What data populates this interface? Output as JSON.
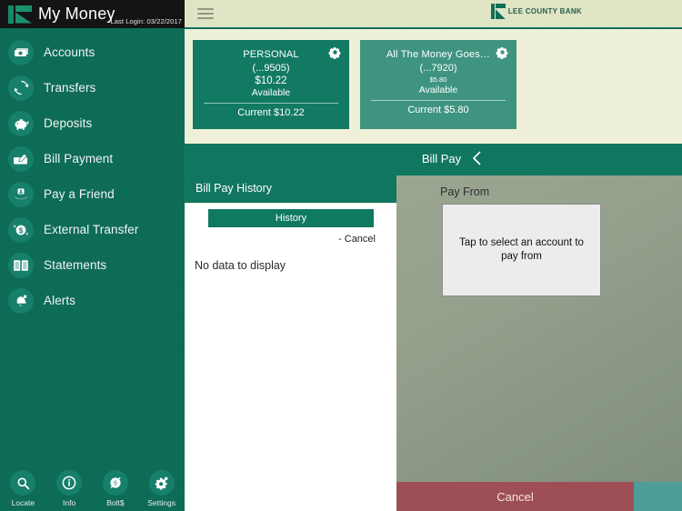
{
  "sidebar": {
    "brand_title": "My Money",
    "last_login": "Last Login: 03/22/2017",
    "brand_mark_icon": "lee-county-bank-logo-mark",
    "items": [
      {
        "label": "Accounts",
        "icon": "money-stack-icon"
      },
      {
        "label": "Transfers",
        "icon": "refresh-arrows-icon"
      },
      {
        "label": "Deposits",
        "icon": "piggy-bank-icon"
      },
      {
        "label": "Bill Payment",
        "icon": "check-pen-icon"
      },
      {
        "label": "Pay a Friend",
        "icon": "person-hand-icon"
      },
      {
        "label": "External Transfer",
        "icon": "dollar-circle-arrows-icon"
      },
      {
        "label": "Statements",
        "icon": "open-book-icon"
      },
      {
        "label": "Alerts",
        "icon": "bell-icon"
      }
    ],
    "tools": [
      {
        "label": "Locate",
        "icon": "search-icon"
      },
      {
        "label": "Info",
        "icon": "info-circle-icon"
      },
      {
        "label": "Bolt$",
        "icon": "bolt-dollar-icon"
      },
      {
        "label": "Settings",
        "icon": "gear-icon"
      }
    ]
  },
  "header": {
    "menu_icon": "hamburger-menu-icon",
    "bank_name": "LEE COUNTY BANK",
    "bank_logo_icon": "lee-county-bank-logo-mark"
  },
  "accounts": [
    {
      "name": "PERSONAL",
      "number": "(...9505)",
      "balance": "$10.22",
      "balance_caption": "Available",
      "current": "Current $10.22",
      "gear_icon": "gear-icon",
      "balance_small": false
    },
    {
      "name": "All The Money Goes…",
      "number": "(...7920)",
      "balance": "$5.80",
      "balance_caption": "Available",
      "current": "Current $5.80",
      "gear_icon": "gear-icon",
      "balance_small": true
    }
  ],
  "billpay_nav": {
    "back_icon": "chevron-left-icon",
    "title": "Bill Pay"
  },
  "history": {
    "section_title": "Bill Pay History",
    "history_button": "History",
    "cancel_link": "- Cancel",
    "empty_message": "No data to display"
  },
  "payfrom": {
    "label": "Pay From",
    "placeholder_text": "Tap to select an account to pay from",
    "cancel_button": "Cancel"
  },
  "colors": {
    "sidebar_green": "#0d6b56",
    "card_green": "#127a62",
    "card_green_secondary": "#3f9480",
    "band_green": "#117660",
    "cream": "#eef0d8",
    "topbar_cream": "#dfe4c4",
    "overlay_gray": "#8d9a88",
    "cancel_maroon": "#9e4f56",
    "teal_strip": "#4d9d98"
  }
}
